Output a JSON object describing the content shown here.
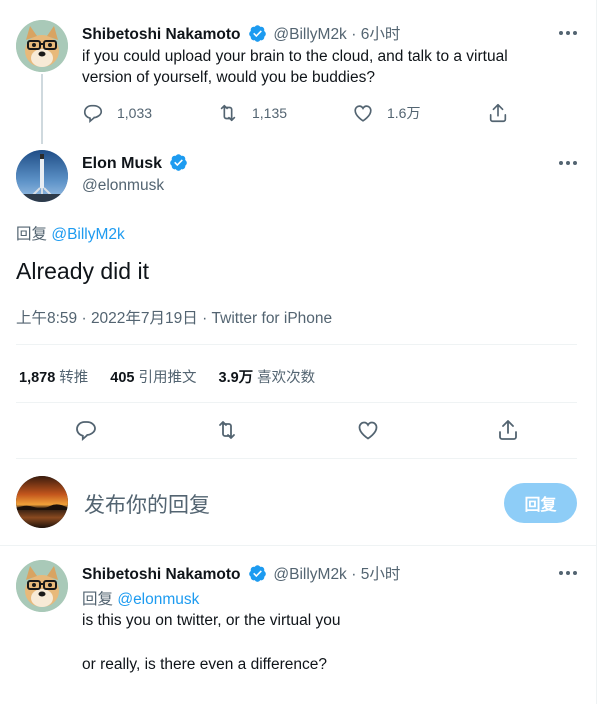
{
  "tweet1": {
    "display_name": "Shibetoshi Nakamoto",
    "handle": "@BillyM2k",
    "time": "· 6小时",
    "text_line1": "if you could upload your brain to the cloud, and talk to a virtual",
    "text_line2": "version of yourself, would you be buddies?",
    "replies": "1,033",
    "retweets": "1,135",
    "likes": "1.6万"
  },
  "main_tweet": {
    "display_name": "Elon Musk",
    "handle": "@elonmusk",
    "reply_prefix": "回复",
    "reply_to": "@BillyM2k",
    "text": "Already did it",
    "timestamp": "上午8:59 · 2022年7月19日 · Twitter for iPhone",
    "stats": {
      "retweets_count": "1,878",
      "retweets_label": "转推",
      "quotes_count": "405",
      "quotes_label": "引用推文",
      "likes_count": "3.9万",
      "likes_label": "喜欢次数"
    }
  },
  "compose": {
    "placeholder": "发布你的回复",
    "button_label": "回复"
  },
  "reply_tweet": {
    "display_name": "Shibetoshi Nakamoto",
    "handle": "@BillyM2k",
    "time": "· 5小时",
    "reply_prefix": "回复",
    "reply_to": "@elonmusk",
    "text_line1": "is this you on twitter, or the virtual you",
    "text_line2": "or really, is there even a difference?"
  },
  "colors": {
    "accent": "#1d9bf0",
    "muted": "#536471",
    "text": "#0f1419",
    "reply_button_disabled": "#8ecdf7"
  },
  "icons": [
    "verified-badge-icon",
    "more-options-icon",
    "reply-icon",
    "retweet-icon",
    "like-icon",
    "share-icon"
  ]
}
